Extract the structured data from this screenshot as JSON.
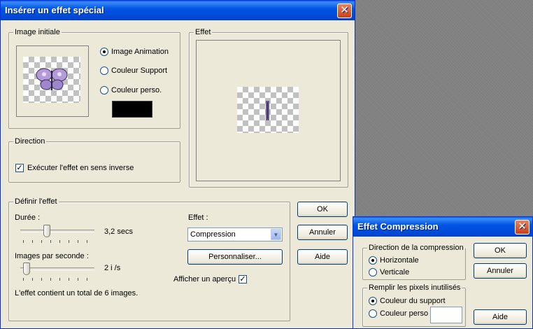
{
  "main_dialog": {
    "title": "Insérer un effet spécial",
    "image_initiale": {
      "label": "Image initiale",
      "options": [
        "Image Animation",
        "Couleur Support",
        "Couleur perso."
      ],
      "selected": 0,
      "custom_color": "#000000"
    },
    "effet_preview": {
      "label": "Effet"
    },
    "direction": {
      "label": "Direction",
      "reverse_label": "Exécuter l'effet en sens inverse",
      "reverse_checked": true
    },
    "definir": {
      "label": "Définir l'effet",
      "duree_label": "Durée :",
      "duree_value": "3,2 secs",
      "duree_level": 0.39,
      "fps_label": "Images par seconde :",
      "fps_value": "2 i /s",
      "fps_level": 0.08,
      "effet_label": "Effet :",
      "effet_selected": "Compression",
      "personnaliser_label": "Personnaliser...",
      "apercu_label": "Afficher un aperçu",
      "apercu_checked": true,
      "total_text": "L'effet contient un total de 6 images."
    },
    "buttons": {
      "ok": "OK",
      "annuler": "Annuler",
      "aide": "Aide"
    }
  },
  "compression_dialog": {
    "title": "Effet Compression",
    "direction": {
      "label": "Direction de la compression",
      "options": [
        "Horizontale",
        "Verticale"
      ],
      "selected": 0
    },
    "remplir": {
      "label": "Remplir les pixels inutilisés",
      "options": [
        "Couleur du support",
        "Couleur perso"
      ],
      "selected": 0
    },
    "buttons": {
      "ok": "OK",
      "annuler": "Annuler",
      "aide": "Aide"
    }
  },
  "colors": {
    "title_blue": "#0055e5",
    "close_red": "#c9401a",
    "dialog_bg": "#ece9d8"
  }
}
